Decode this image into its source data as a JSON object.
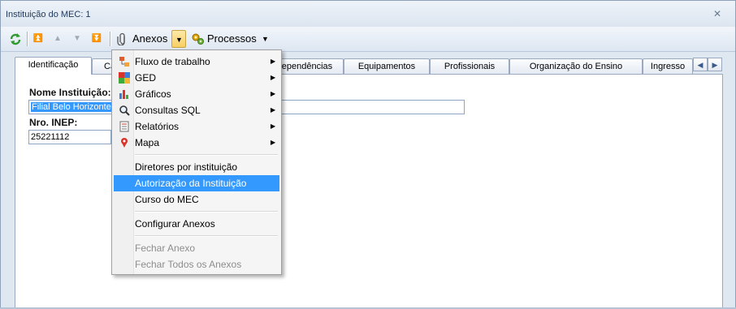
{
  "window": {
    "title": "Instituição do MEC: 1",
    "close_icon": "close-icon"
  },
  "toolbar": {
    "refresh_icon": "refresh-icon",
    "anexos_label": "Anexos",
    "processos_label": "Processos"
  },
  "tabs": [
    "Identificação",
    "Ca",
    "Dependências",
    "Equipamentos",
    "Profissionais",
    "Organização do Ensino",
    "Ingresso"
  ],
  "form": {
    "nome_label": "Nome Instituição:",
    "nome_value": "Filial Belo Horizonte (a",
    "inep_label": "Nro. INEP:",
    "inep_value": "25221112"
  },
  "menu": {
    "submenus": [
      {
        "label": "Fluxo de trabalho",
        "icon": "workflow-icon"
      },
      {
        "label": "GED",
        "icon": "ged-icon"
      },
      {
        "label": "Gráficos",
        "icon": "chart-icon"
      },
      {
        "label": "Consultas SQL",
        "icon": "sql-query-icon"
      },
      {
        "label": "Relatórios",
        "icon": "report-icon"
      },
      {
        "label": "Mapa",
        "icon": "map-pin-icon"
      }
    ],
    "items": [
      "Diretores por instituição",
      "Autorização da Instituição",
      "Curso do MEC"
    ],
    "configure": "Configurar Anexos",
    "disabled": [
      "Fechar Anexo",
      "Fechar Todos os Anexos"
    ],
    "highlighted": "Autorização da Instituição"
  },
  "colors": {
    "highlight": "#3399ff",
    "window_bg": "#dfe7f1",
    "title_text": "#1e395b"
  }
}
